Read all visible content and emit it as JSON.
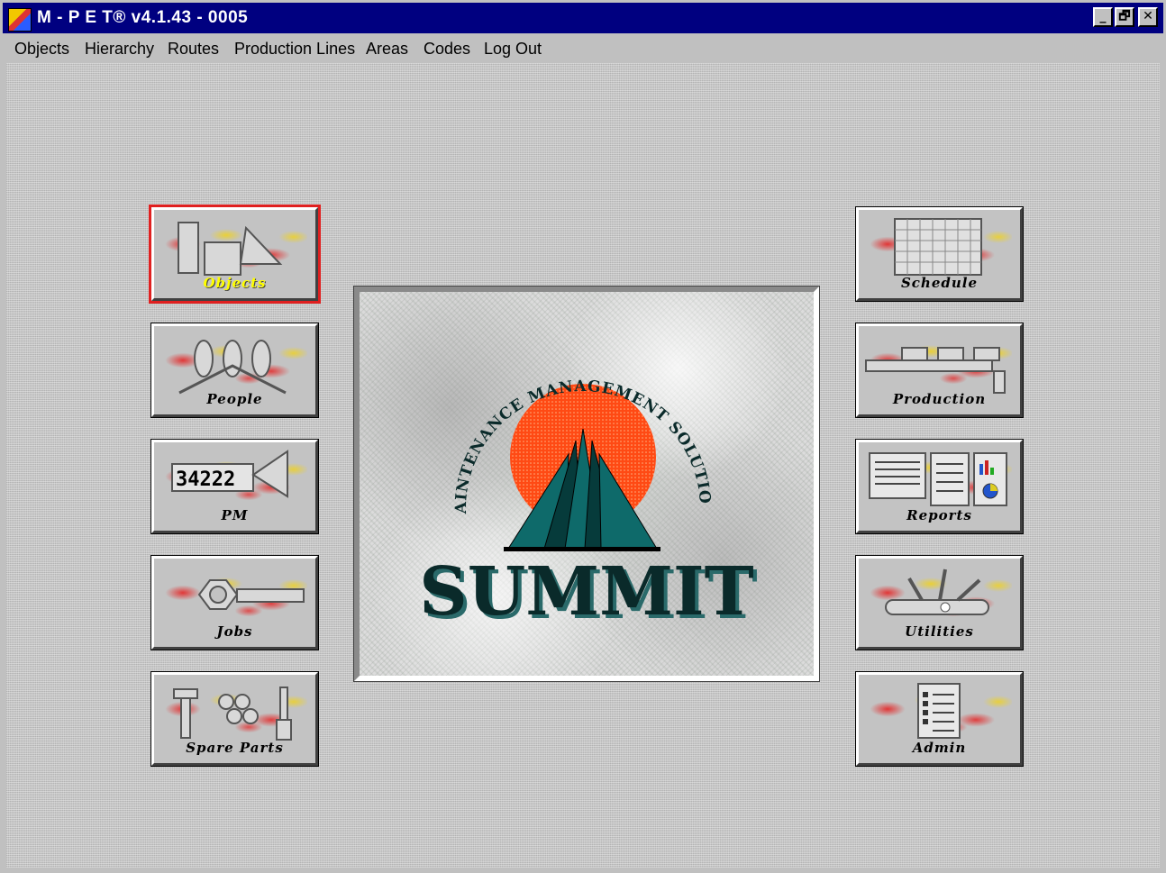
{
  "titlebar": {
    "title": "M - P E T® v4.1.43 - 0005",
    "buttons": [
      "_",
      "🗗",
      "✕"
    ]
  },
  "menu": {
    "items": [
      "Objects",
      "Hierarchy",
      "Routes",
      "Production Lines",
      "Areas",
      "Codes",
      "Log Out"
    ]
  },
  "left_buttons": [
    {
      "label": "Objects",
      "icon": "objects-icon",
      "selected": true
    },
    {
      "label": "People",
      "icon": "people-icon"
    },
    {
      "label": "PM",
      "icon": "pm-counter-icon"
    },
    {
      "label": "Jobs",
      "icon": "wrench-icon"
    },
    {
      "label": "Spare Parts",
      "icon": "spare-parts-icon"
    }
  ],
  "right_buttons": [
    {
      "label": "Schedule",
      "icon": "calendar-grid-icon"
    },
    {
      "label": "Production",
      "icon": "production-line-icon"
    },
    {
      "label": "Reports",
      "icon": "reports-icon"
    },
    {
      "label": "Utilities",
      "icon": "multitool-icon"
    },
    {
      "label": "Admin",
      "icon": "checklist-icon"
    }
  ],
  "logo": {
    "arc_text": "MAINTENANCE MANAGEMENT SOLUTIONS",
    "brand": "SUMMIT",
    "colors": {
      "sun": "#ff4a14",
      "peaks": "#0e6a6a",
      "text": "#0a2a2a"
    }
  },
  "pm_icon_digits": "34222"
}
